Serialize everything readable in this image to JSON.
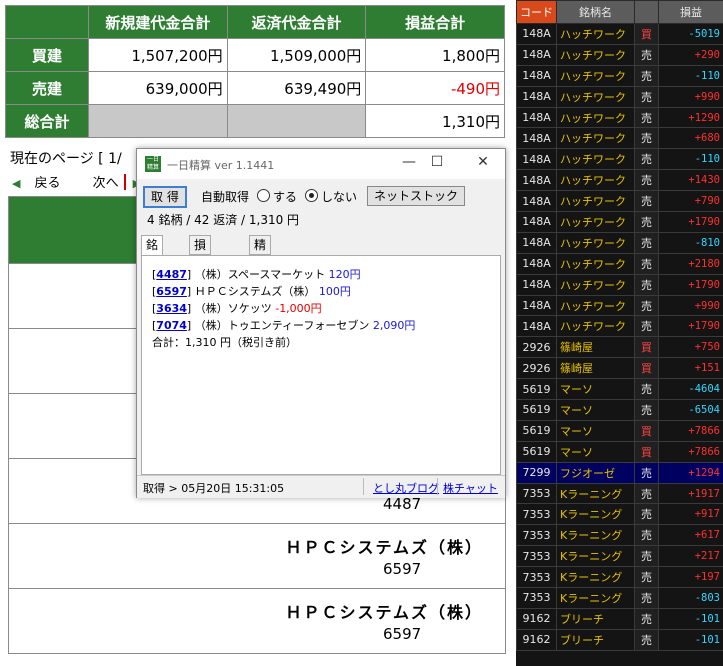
{
  "summary": {
    "headers": [
      "新規建代金合計",
      "返済代金合計",
      "損益合計"
    ],
    "rows": [
      {
        "label": "買建",
        "new": "1,507,200円",
        "repay": "1,509,000円",
        "pl": "1,800円"
      },
      {
        "label": "売建",
        "new": "639,000円",
        "repay": "639,490円",
        "pl": "-490円"
      },
      {
        "label": "総合計",
        "new": "",
        "repay": "",
        "pl": "1,310円"
      }
    ]
  },
  "nav": {
    "page_text": "現在のページ [ 1/",
    "back": "戻る",
    "next": "次へ"
  },
  "list": {
    "rows": [
      {
        "name": "",
        "code": ""
      },
      {
        "name": "",
        "code": ""
      },
      {
        "name": "",
        "code": ""
      },
      {
        "name": "",
        "code": "4487"
      },
      {
        "name": "ＨＰＣシステムズ（株）",
        "code": "6597"
      },
      {
        "name": "ＨＰＣシステムズ（株）",
        "code": "6597"
      }
    ]
  },
  "panel": {
    "headers": [
      "コード",
      "銘柄名",
      "",
      "損益"
    ],
    "rows": [
      {
        "code": "148A",
        "name": "ハッチワーク",
        "side": "買",
        "pl": "-5019",
        "dir": "neg"
      },
      {
        "code": "148A",
        "name": "ハッチワーク",
        "side": "売",
        "pl": "+290",
        "dir": "pos"
      },
      {
        "code": "148A",
        "name": "ハッチワーク",
        "side": "売",
        "pl": "-110",
        "dir": "neg"
      },
      {
        "code": "148A",
        "name": "ハッチワーク",
        "side": "売",
        "pl": "+990",
        "dir": "pos"
      },
      {
        "code": "148A",
        "name": "ハッチワーク",
        "side": "売",
        "pl": "+1290",
        "dir": "pos"
      },
      {
        "code": "148A",
        "name": "ハッチワーク",
        "side": "売",
        "pl": "+680",
        "dir": "pos"
      },
      {
        "code": "148A",
        "name": "ハッチワーク",
        "side": "売",
        "pl": "-110",
        "dir": "neg"
      },
      {
        "code": "148A",
        "name": "ハッチワーク",
        "side": "売",
        "pl": "+1430",
        "dir": "pos"
      },
      {
        "code": "148A",
        "name": "ハッチワーク",
        "side": "売",
        "pl": "+790",
        "dir": "pos"
      },
      {
        "code": "148A",
        "name": "ハッチワーク",
        "side": "売",
        "pl": "+1790",
        "dir": "pos"
      },
      {
        "code": "148A",
        "name": "ハッチワーク",
        "side": "売",
        "pl": "-810",
        "dir": "neg"
      },
      {
        "code": "148A",
        "name": "ハッチワーク",
        "side": "売",
        "pl": "+2180",
        "dir": "pos"
      },
      {
        "code": "148A",
        "name": "ハッチワーク",
        "side": "売",
        "pl": "+1790",
        "dir": "pos"
      },
      {
        "code": "148A",
        "name": "ハッチワーク",
        "side": "売",
        "pl": "+990",
        "dir": "pos"
      },
      {
        "code": "148A",
        "name": "ハッチワーク",
        "side": "売",
        "pl": "+1790",
        "dir": "pos"
      },
      {
        "code": "2926",
        "name": "篠崎屋",
        "side": "買",
        "pl": "+750",
        "dir": "pos"
      },
      {
        "code": "2926",
        "name": "篠崎屋",
        "side": "買",
        "pl": "+151",
        "dir": "pos"
      },
      {
        "code": "5619",
        "name": "マーソ",
        "side": "売",
        "pl": "-4604",
        "dir": "neg"
      },
      {
        "code": "5619",
        "name": "マーソ",
        "side": "売",
        "pl": "-6504",
        "dir": "neg"
      },
      {
        "code": "5619",
        "name": "マーソ",
        "side": "買",
        "pl": "+7866",
        "dir": "pos"
      },
      {
        "code": "5619",
        "name": "マーソ",
        "side": "買",
        "pl": "+7866",
        "dir": "pos"
      },
      {
        "code": "7299",
        "name": "フジオーゼ",
        "side": "売",
        "pl": "+1294",
        "dir": "pos",
        "highlight": true
      },
      {
        "code": "7353",
        "name": "Kラーニング",
        "side": "売",
        "pl": "+1917",
        "dir": "pos"
      },
      {
        "code": "7353",
        "name": "Kラーニング",
        "side": "売",
        "pl": "+917",
        "dir": "pos"
      },
      {
        "code": "7353",
        "name": "Kラーニング",
        "side": "売",
        "pl": "+617",
        "dir": "pos"
      },
      {
        "code": "7353",
        "name": "Kラーニング",
        "side": "売",
        "pl": "+217",
        "dir": "pos"
      },
      {
        "code": "7353",
        "name": "Kラーニング",
        "side": "売",
        "pl": "+197",
        "dir": "pos"
      },
      {
        "code": "7353",
        "name": "Kラーニング",
        "side": "売",
        "pl": "-803",
        "dir": "neg"
      },
      {
        "code": "9162",
        "name": "ブリーチ",
        "side": "売",
        "pl": "-101",
        "dir": "neg"
      },
      {
        "code": "9162",
        "name": "ブリーチ",
        "side": "売",
        "pl": "-101",
        "dir": "neg"
      }
    ]
  },
  "dialog": {
    "icon_text": "一日精算",
    "title": "一日精算 ver 1.1441",
    "minimize": "—",
    "maximize": "☐",
    "close": "✕",
    "get_button": "取 得",
    "auto_label": "自動取得",
    "radio_on": "する",
    "radio_off": "しない",
    "net_button": "ネットストック",
    "summary_line": "4 銘柄 / 42 返済 / 1,310 円",
    "tabs": [
      "銘柄別",
      "損益推移",
      "精算表"
    ],
    "entries": [
      {
        "code": "4487",
        "name": "（株）スペースマーケット",
        "value": "120円",
        "neg": false
      },
      {
        "code": "6597",
        "name": "ＨＰＣシステムズ（株）",
        "value": "100円",
        "neg": false
      },
      {
        "code": "3634",
        "name": "（株）ソケッツ",
        "value": "-1,000円",
        "neg": true
      },
      {
        "code": "7074",
        "name": "（株）トゥエンティーフォーセブン",
        "value": "2,090円",
        "neg": false
      }
    ],
    "total_line": "合計：1,310 円（税引き前）",
    "status": "取得 > 05月20日 15:31:05",
    "link_blog": "とし丸ブログ",
    "link_chart": "株チャット"
  }
}
